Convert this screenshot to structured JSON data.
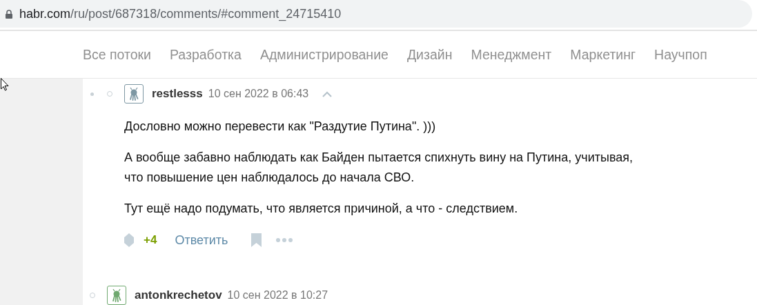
{
  "address_bar": {
    "host": "habr.com",
    "path": "/ru/post/687318/comments/#comment_24715410"
  },
  "nav": {
    "items": [
      "Все потоки",
      "Разработка",
      "Администрирование",
      "Дизайн",
      "Менеджмент",
      "Маркетинг",
      "Научпоп"
    ]
  },
  "comments": [
    {
      "thread_marks": [
        {
          "kind": "dot"
        },
        {
          "kind": "circle"
        }
      ],
      "color": "#7d97a3",
      "author": "restlesss",
      "date": "10 сен 2022 в 06:43",
      "collapse": true,
      "paragraphs": [
        "Дословно можно перевести как \"Раздутие Путина\". )))",
        "А вообще забавно наблюдать как Байден пытается спихнуть вину на Путина, учитывая, что повышение цен наблюдалось до начала СВО.",
        "Тут ещё надо подумать, что является причиной, а что - следствием."
      ],
      "score": "+4",
      "reply": "Ответить"
    },
    {
      "thread_marks": [
        {
          "kind": "circle"
        }
      ],
      "color": "#6fa86f",
      "author": "antonkrechetov",
      "date": "10 сен 2022 в 10:27",
      "collapse": false
    }
  ]
}
